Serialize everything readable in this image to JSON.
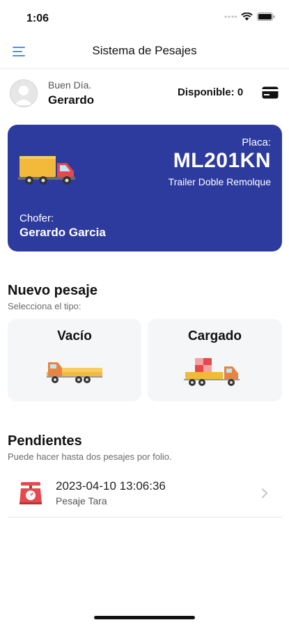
{
  "status_bar": {
    "time": "1:06"
  },
  "nav": {
    "title": "Sistema de Pesajes"
  },
  "user": {
    "greeting": "Buen Día.",
    "name": "Gerardo",
    "available": "Disponible: 0"
  },
  "vehicle": {
    "plate_label": "Placa:",
    "plate": "ML201KN",
    "type": "Trailer Doble Remolque",
    "driver_label": "Chofer:",
    "driver_name": "Gerardo Garcia"
  },
  "new_weighing": {
    "title": "Nuevo pesaje",
    "subtitle": "Selecciona el tipo:",
    "options": [
      {
        "label": "Vacío"
      },
      {
        "label": "Cargado"
      }
    ]
  },
  "pending": {
    "title": "Pendientes",
    "subtitle": "Puede hacer hasta dos pesajes por folio.",
    "items": [
      {
        "datetime": "2023-04-10 13:06:36",
        "type": "Pesaje Tara"
      }
    ]
  },
  "colors": {
    "card_bg": "#2e3b9e",
    "accent_blue": "#4a8ff0",
    "scale_red": "#e5484d",
    "truck_yellow": "#f3b93b"
  }
}
